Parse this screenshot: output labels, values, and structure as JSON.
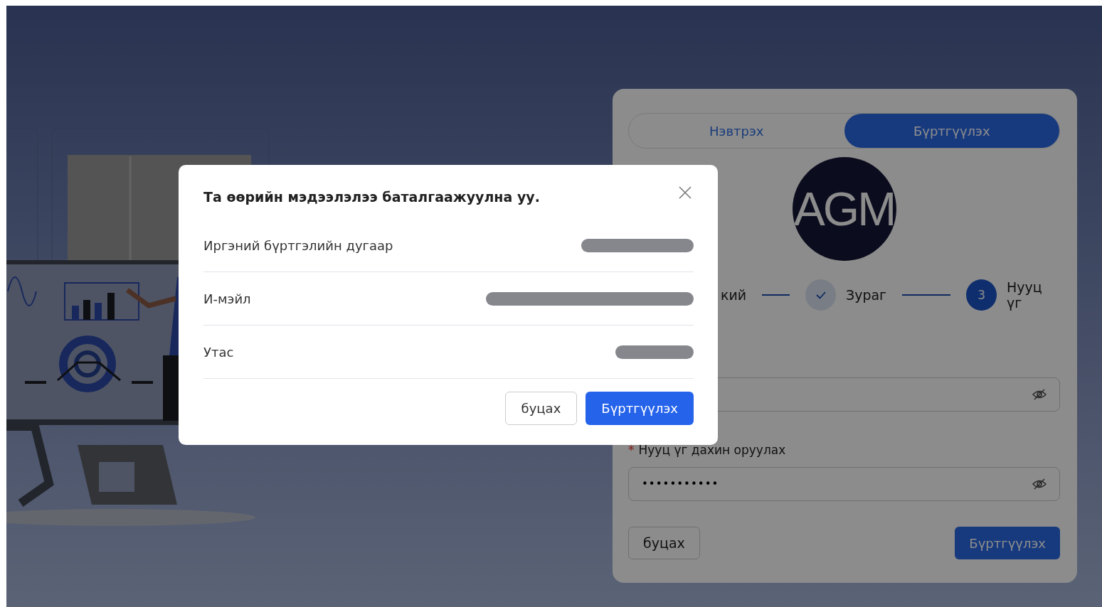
{
  "auth_card": {
    "tabs": [
      {
        "label": "Нэвтрэх",
        "selected": false
      },
      {
        "label": "Бүртгүүлэх",
        "selected": true
      }
    ],
    "logo": {
      "text": "AGM"
    },
    "steps": [
      {
        "label": "кий"
      },
      {
        "label": "Зураг",
        "done": true
      },
      {
        "label": "Нууц үг",
        "current": true,
        "number": "3"
      }
    ],
    "fields": [
      {
        "kind": "password"
      },
      {
        "kind": "password",
        "label": "Нууц үг дахин оруулах",
        "required_mark": "*",
        "value": "•••••••••••"
      }
    ],
    "buttons": {
      "back": "буцах",
      "submit": "Бүртгүүлэх"
    }
  },
  "dialog": {
    "title": "Та өөрийн мэдээлэлээ баталгаажуулна уу.",
    "rows": [
      {
        "label": "Иргэний бүртгэлийн дугаар"
      },
      {
        "label": "И-мэйл"
      },
      {
        "label": "Утас"
      }
    ],
    "buttons": {
      "cancel": "буцах",
      "confirm": "Бүртгүүлэх"
    }
  }
}
